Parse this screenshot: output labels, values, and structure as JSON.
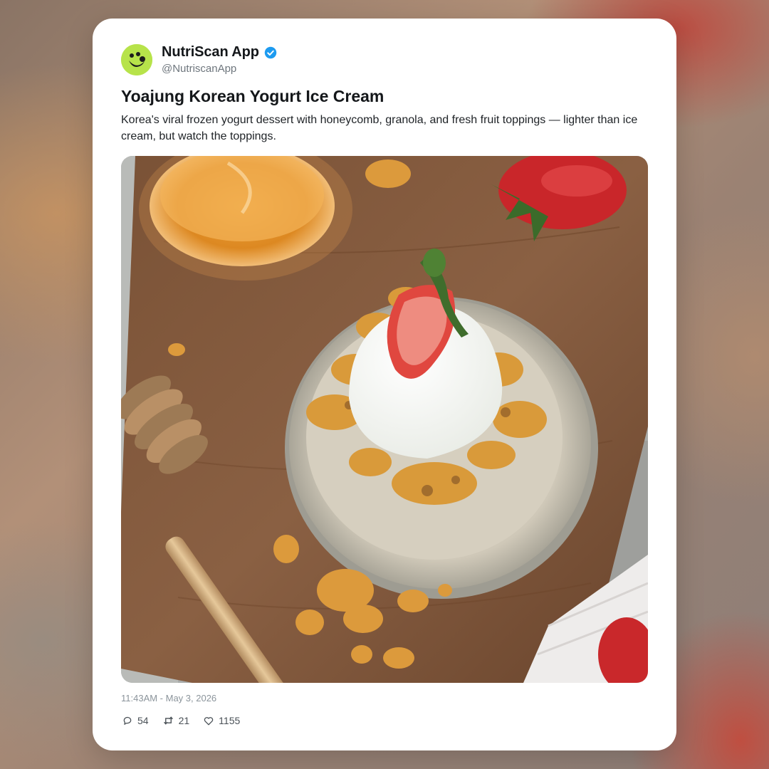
{
  "post": {
    "account": {
      "name": "NutriScan App",
      "handle": "@NutriscanApp",
      "verified": true,
      "avatar_color": "#b7e34a",
      "verified_color": "#1d9bf0"
    },
    "title": "Yoajung Korean Yogurt Ice Cream",
    "description": "Korea's viral frozen yogurt dessert with honeycomb, granola, and fresh fruit toppings — lighter than ice cream, but watch the toppings.",
    "timestamp": "11:43AM - May 3, 2026",
    "stats": {
      "replies": "54",
      "retweets": "21",
      "likes": "1155"
    },
    "icons": {
      "reply": "reply-icon",
      "retweet": "retweet-icon",
      "like": "heart-icon",
      "verified": "verified-badge-icon",
      "avatar": "smiley-logo-icon"
    }
  }
}
